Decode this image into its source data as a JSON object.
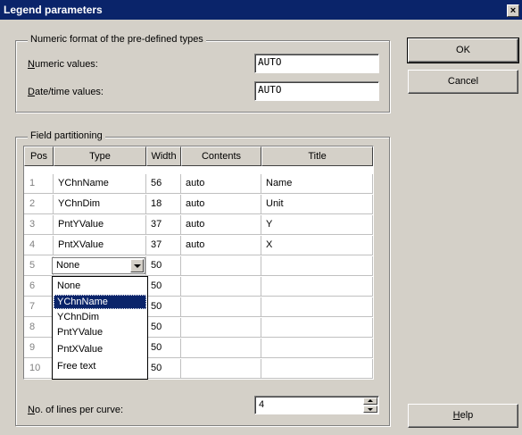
{
  "window": {
    "title": "Legend parameters",
    "close_glyph": "×"
  },
  "numeric_group": {
    "title": "Numeric format of the pre-defined types",
    "numeric_label_u": "N",
    "numeric_label_rest": "umeric values:",
    "numeric_value": "AUTO",
    "date_label_u": "D",
    "date_label_rest": "ate/time values:",
    "date_value": "AUTO"
  },
  "partition_group": {
    "title": "Field partitioning",
    "columns": [
      "Pos",
      "Type",
      "Width",
      "Contents",
      "Title"
    ],
    "rows": [
      {
        "pos": "1",
        "type": "YChnName",
        "width": "56",
        "contents": "auto",
        "title": "Name"
      },
      {
        "pos": "2",
        "type": "YChnDim",
        "width": "18",
        "contents": "auto",
        "title": "Unit"
      },
      {
        "pos": "3",
        "type": "PntYValue",
        "width": "37",
        "contents": "auto",
        "title": "Y"
      },
      {
        "pos": "4",
        "type": "PntXValue",
        "width": "37",
        "contents": "auto",
        "title": "X"
      },
      {
        "pos": "5",
        "type": "",
        "width": "50",
        "contents": "",
        "title": ""
      },
      {
        "pos": "6",
        "type": "",
        "width": "50",
        "contents": "",
        "title": ""
      },
      {
        "pos": "7",
        "type": "",
        "width": "50",
        "contents": "",
        "title": ""
      },
      {
        "pos": "8",
        "type": "",
        "width": "50",
        "contents": "",
        "title": ""
      },
      {
        "pos": "9",
        "type": "",
        "width": "50",
        "contents": "",
        "title": ""
      },
      {
        "pos": "10",
        "type": "",
        "width": "50",
        "contents": "",
        "title": ""
      }
    ],
    "combo_value": "None",
    "dropdown_options": [
      "None",
      "YChnName",
      "YChnDim",
      "PntYValue",
      "PntXValue",
      "Free text"
    ],
    "dropdown_selected": "YChnName"
  },
  "lines": {
    "label_u": "N",
    "label_rest": "o. of lines per curve:",
    "value": "4"
  },
  "buttons": {
    "ok": "OK",
    "cancel": "Cancel",
    "help_u": "H",
    "help_rest": "elp"
  }
}
